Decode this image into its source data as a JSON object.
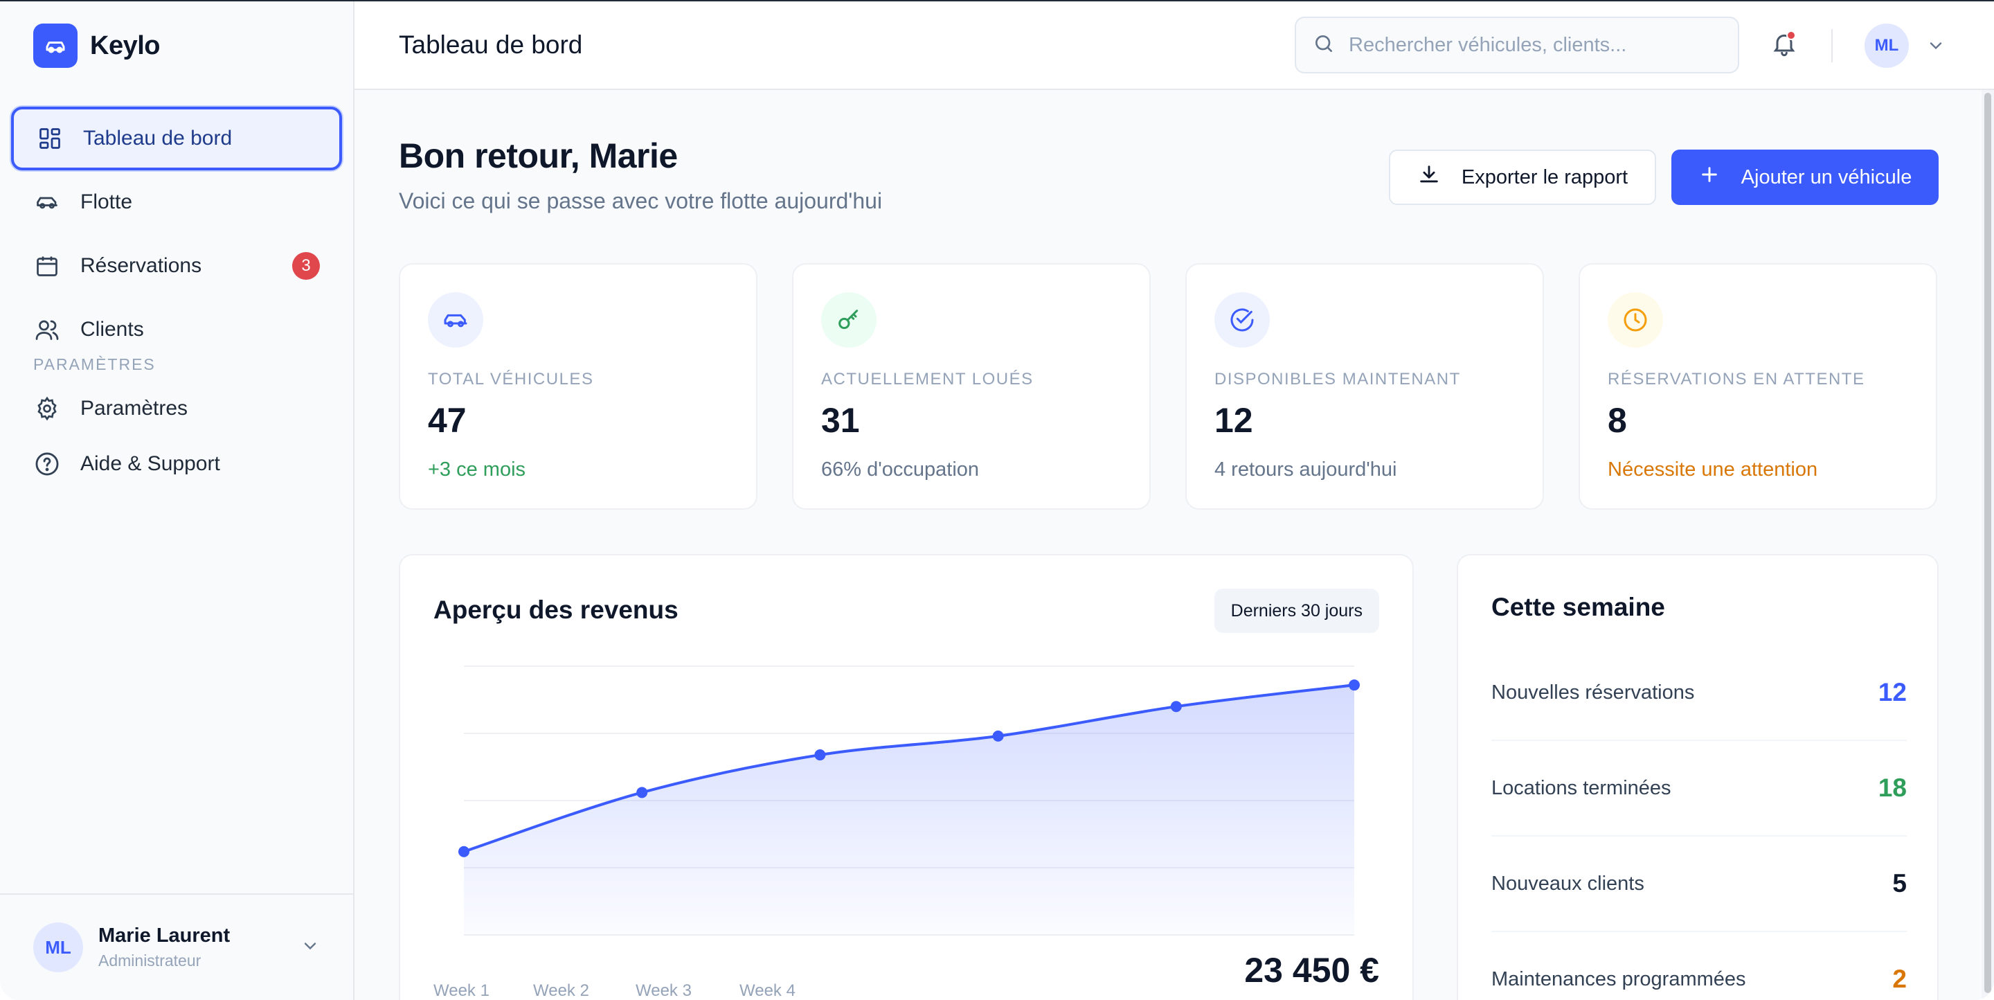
{
  "brand": {
    "name": "Keylo"
  },
  "sidebar": {
    "items": [
      {
        "label": "Tableau de bord",
        "icon": "dashboard-icon",
        "active": true
      },
      {
        "label": "Flotte",
        "icon": "car-icon"
      },
      {
        "label": "Réservations",
        "icon": "calendar-icon",
        "badge": "3"
      },
      {
        "label": "Clients",
        "icon": "users-icon"
      }
    ],
    "section_label": "PARAMÈTRES",
    "settings_items": [
      {
        "label": "Paramètres",
        "icon": "gear-icon"
      },
      {
        "label": "Aide & Support",
        "icon": "help-icon"
      }
    ],
    "user": {
      "initials": "ML",
      "name": "Marie Laurent",
      "role": "Administrateur"
    }
  },
  "topbar": {
    "title": "Tableau de bord",
    "search_placeholder": "Rechercher véhicules, clients...",
    "avatar_initials": "ML"
  },
  "welcome": {
    "title": "Bon retour, Marie",
    "subtitle": "Voici ce qui se passe avec votre flotte aujourd'hui",
    "export_label": "Exporter le rapport",
    "add_label": "Ajouter un véhicule"
  },
  "stats": [
    {
      "label": "TOTAL VÉHICULES",
      "value": "47",
      "note": "+3 ce mois",
      "note_color": "#2f9e5b",
      "icon": "car-icon",
      "icon_bg": "#eef2ff",
      "icon_color": "#3b5bfd"
    },
    {
      "label": "ACTUELLEMENT LOUÉS",
      "value": "31",
      "note": "66% d'occupation",
      "note_color": "#64748b",
      "icon": "key-icon",
      "icon_bg": "#ecfdf3",
      "icon_color": "#2f9e5b"
    },
    {
      "label": "DISPONIBLES MAINTENANT",
      "value": "12",
      "note": "4 retours aujourd'hui",
      "note_color": "#64748b",
      "icon": "check-circle-icon",
      "icon_bg": "#eef2ff",
      "icon_color": "#3b5bfd"
    },
    {
      "label": "RÉSERVATIONS EN ATTENTE",
      "value": "8",
      "note": "Nécessite une attention",
      "note_color": "#d97706",
      "icon": "clock-icon",
      "icon_bg": "#fffbeb",
      "icon_color": "#f59e0b"
    }
  ],
  "revenue": {
    "title": "Aperçu des revenus",
    "range_label": "Derniers 30 jours",
    "total": "23 450 €"
  },
  "chart_data": {
    "type": "area",
    "categories": [
      "Week 1",
      "Week 2",
      "Week 3",
      "Week 4"
    ],
    "series": [
      {
        "values": [
          0.31,
          0.53,
          0.67,
          0.74,
          0.85,
          0.93
        ]
      }
    ],
    "ylim": [
      0,
      1
    ],
    "grid": true,
    "color": "#3b5bfd",
    "title": "",
    "xlabel": "",
    "ylabel": ""
  },
  "week": {
    "title": "Cette semaine",
    "rows": [
      {
        "label": "Nouvelles réservations",
        "value": "12",
        "color": "#3b5bfd"
      },
      {
        "label": "Locations terminées",
        "value": "18",
        "color": "#2f9e5b"
      },
      {
        "label": "Nouveaux clients",
        "value": "5",
        "color": "#0f172a"
      },
      {
        "label": "Maintenances programmées",
        "value": "2",
        "color": "#d97706"
      }
    ]
  }
}
